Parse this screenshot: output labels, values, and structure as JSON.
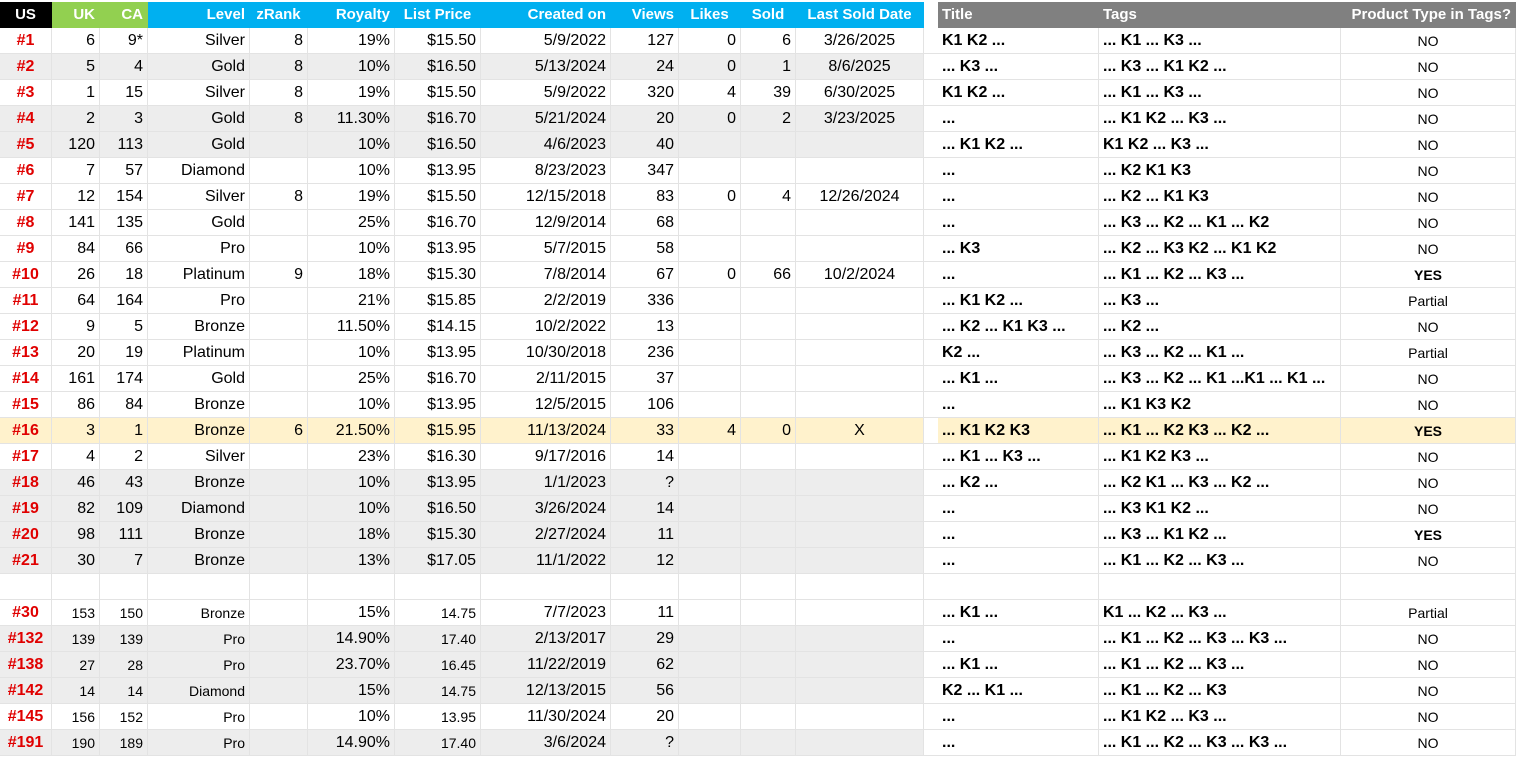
{
  "colors": {
    "us_header": "#000000",
    "uk_ca_header": "#92d050",
    "main_header": "#00b0f0",
    "right_header": "#808080",
    "rank_red": "#e00000",
    "shade": "#ededed",
    "highlight": "#fff2cc"
  },
  "headers": {
    "us": "US",
    "uk": "UK",
    "ca": "CA",
    "level": "Level",
    "zrank": "zRank",
    "royalty": "Royalty",
    "list_price": "List Price",
    "created_on": "Created on",
    "views": "Views",
    "likes": "Likes",
    "sold": "Sold",
    "last_sold_date": "Last Sold Date",
    "title": "Title",
    "tags": "Tags",
    "product_type": "Product Type in Tags?"
  },
  "rows": [
    {
      "us": "#1",
      "uk": "6",
      "ca": "9*",
      "level": "Silver",
      "zrank": "8",
      "royalty": "19%",
      "price": "$15.50",
      "created": "5/9/2022",
      "views": "127",
      "likes": "0",
      "sold": "6",
      "last_sold": "3/26/2025",
      "title": "K1 K2 ...",
      "tags": "... K1 ... K3 ...",
      "ptype": "NO"
    },
    {
      "us": "#2",
      "uk": "5",
      "ca": "4",
      "level": "Gold",
      "zrank": "8",
      "royalty": "10%",
      "price": "$16.50",
      "created": "5/13/2024",
      "views": "24",
      "likes": "0",
      "sold": "1",
      "last_sold": "8/6/2025",
      "title": "... K3 ...",
      "tags": "... K3 ... K1 K2 ...",
      "ptype": "NO"
    },
    {
      "us": "#3",
      "uk": "1",
      "ca": "15",
      "level": "Silver",
      "zrank": "8",
      "royalty": "19%",
      "price": "$15.50",
      "created": "5/9/2022",
      "views": "320",
      "likes": "4",
      "sold": "39",
      "last_sold": "6/30/2025",
      "title": "K1 K2 ...",
      "tags": "... K1 ... K3 ...",
      "ptype": "NO"
    },
    {
      "us": "#4",
      "uk": "2",
      "ca": "3",
      "level": "Gold",
      "zrank": "8",
      "royalty": "11.30%",
      "price": "$16.70",
      "created": "5/21/2024",
      "views": "20",
      "likes": "0",
      "sold": "2",
      "last_sold": "3/23/2025",
      "title": "...",
      "tags": "... K1 K2 ... K3 ...",
      "ptype": "NO"
    },
    {
      "us": "#5",
      "uk": "120",
      "ca": "113",
      "level": "Gold",
      "zrank": "",
      "royalty": "10%",
      "price": "$16.50",
      "created": "4/6/2023",
      "views": "40",
      "likes": "",
      "sold": "",
      "last_sold": "",
      "title": "... K1 K2 ...",
      "tags": "K1 K2 ... K3 ...",
      "ptype": "NO"
    },
    {
      "us": "#6",
      "uk": "7",
      "ca": "57",
      "level": "Diamond",
      "zrank": "",
      "royalty": "10%",
      "price": "$13.95",
      "created": "8/23/2023",
      "views": "347",
      "likes": "",
      "sold": "",
      "last_sold": "",
      "title": "...",
      "tags": "... K2 K1 K3",
      "ptype": "NO"
    },
    {
      "us": "#7",
      "uk": "12",
      "ca": "154",
      "level": "Silver",
      "zrank": "8",
      "royalty": "19%",
      "price": "$15.50",
      "created": "12/15/2018",
      "views": "83",
      "likes": "0",
      "sold": "4",
      "last_sold": "12/26/2024",
      "title": "...",
      "tags": "... K2 ... K1 K3",
      "ptype": "NO"
    },
    {
      "us": "#8",
      "uk": "141",
      "ca": "135",
      "level": "Gold",
      "zrank": "",
      "royalty": "25%",
      "price": "$16.70",
      "created": "12/9/2014",
      "views": "68",
      "likes": "",
      "sold": "",
      "last_sold": "",
      "title": "...",
      "tags": "... K3 ... K2 ... K1 ... K2",
      "ptype": "NO"
    },
    {
      "us": "#9",
      "uk": "84",
      "ca": "66",
      "level": "Pro",
      "zrank": "",
      "royalty": "10%",
      "price": "$13.95",
      "created": "5/7/2015",
      "views": "58",
      "likes": "",
      "sold": "",
      "last_sold": "",
      "title": "... K3",
      "tags": "... K2 ... K3 K2 ... K1 K2",
      "ptype": "NO"
    },
    {
      "us": "#10",
      "uk": "26",
      "ca": "18",
      "level": "Platinum",
      "zrank": "9",
      "royalty": "18%",
      "price": "$15.30",
      "created": "7/8/2014",
      "views": "67",
      "likes": "0",
      "sold": "66",
      "last_sold": "10/2/2024",
      "title": "...",
      "tags": "... K1 ... K2 ... K3 ...",
      "ptype": "YES"
    },
    {
      "us": "#11",
      "uk": "64",
      "ca": "164",
      "level": "Pro",
      "zrank": "",
      "royalty": "21%",
      "price": "$15.85",
      "created": "2/2/2019",
      "views": "336",
      "likes": "",
      "sold": "",
      "last_sold": "",
      "title": "... K1 K2 ...",
      "tags": "... K3 ...",
      "ptype": "Partial"
    },
    {
      "us": "#12",
      "uk": "9",
      "ca": "5",
      "level": "Bronze",
      "zrank": "",
      "royalty": "11.50%",
      "price": "$14.15",
      "created": "10/2/2022",
      "views": "13",
      "likes": "",
      "sold": "",
      "last_sold": "",
      "title": "... K2 ... K1 K3 ...",
      "tags": "... K2 ...",
      "ptype": "NO"
    },
    {
      "us": "#13",
      "uk": "20",
      "ca": "19",
      "level": "Platinum",
      "zrank": "",
      "royalty": "10%",
      "price": "$13.95",
      "created": "10/30/2018",
      "views": "236",
      "likes": "",
      "sold": "",
      "last_sold": "",
      "title": "K2 ...",
      "tags": "... K3 ... K2 ... K1 ...",
      "ptype": "Partial"
    },
    {
      "us": "#14",
      "uk": "161",
      "ca": "174",
      "level": "Gold",
      "zrank": "",
      "royalty": "25%",
      "price": "$16.70",
      "created": "2/11/2015",
      "views": "37",
      "likes": "",
      "sold": "",
      "last_sold": "",
      "title": "... K1 ...",
      "tags": "... K3 ... K2 ... K1 ...K1 ... K1 ...",
      "ptype": "NO"
    },
    {
      "us": "#15",
      "uk": "86",
      "ca": "84",
      "level": "Bronze",
      "zrank": "",
      "royalty": "10%",
      "price": "$13.95",
      "created": "12/5/2015",
      "views": "106",
      "likes": "",
      "sold": "",
      "last_sold": "",
      "title": "...",
      "tags": "... K1 K3 K2",
      "ptype": "NO"
    },
    {
      "us": "#16",
      "uk": "3",
      "ca": "1",
      "level": "Bronze",
      "zrank": "6",
      "royalty": "21.50%",
      "price": "$15.95",
      "created": "11/13/2024",
      "views": "33",
      "likes": "4",
      "sold": "0",
      "last_sold": "X",
      "title": "... K1 K2 K3",
      "tags": "... K1 ... K2 K3 ... K2 ...",
      "ptype": "YES"
    },
    {
      "us": "#17",
      "uk": "4",
      "ca": "2",
      "level": "Silver",
      "zrank": "",
      "royalty": "23%",
      "price": "$16.30",
      "created": "9/17/2016",
      "views": "14",
      "likes": "",
      "sold": "",
      "last_sold": "",
      "title": "... K1 ... K3 ...",
      "tags": "... K1 K2 K3 ...",
      "ptype": "NO"
    },
    {
      "us": "#18",
      "uk": "46",
      "ca": "43",
      "level": "Bronze",
      "zrank": "",
      "royalty": "10%",
      "price": "$13.95",
      "created": "1/1/2023",
      "views": "?",
      "likes": "",
      "sold": "",
      "last_sold": "",
      "title": "... K2 ...",
      "tags": "... K2 K1 ... K3 ... K2 ...",
      "ptype": "NO"
    },
    {
      "us": "#19",
      "uk": "82",
      "ca": "109",
      "level": "Diamond",
      "zrank": "",
      "royalty": "10%",
      "price": "$16.50",
      "created": "3/26/2024",
      "views": "14",
      "likes": "",
      "sold": "",
      "last_sold": "",
      "title": "...",
      "tags": "... K3 K1 K2 ...",
      "ptype": "NO"
    },
    {
      "us": "#20",
      "uk": "98",
      "ca": "111",
      "level": "Bronze",
      "zrank": "",
      "royalty": "18%",
      "price": "$15.30",
      "created": "2/27/2024",
      "views": "11",
      "likes": "",
      "sold": "",
      "last_sold": "",
      "title": "...",
      "tags": "... K3 ... K1 K2 ...",
      "ptype": "YES"
    },
    {
      "us": "#21",
      "uk": "30",
      "ca": "7",
      "level": "Bronze",
      "zrank": "",
      "royalty": "13%",
      "price": "$17.05",
      "created": "11/1/2022",
      "views": "12",
      "likes": "",
      "sold": "",
      "last_sold": "",
      "title": "...",
      "tags": "... K1 ... K2 ... K3 ...",
      "ptype": "NO"
    },
    {
      "us": "",
      "uk": "",
      "ca": "",
      "level": "",
      "zrank": "",
      "royalty": "",
      "price": "",
      "created": "",
      "views": "",
      "likes": "",
      "sold": "",
      "last_sold": "",
      "title": "",
      "tags": "",
      "ptype": ""
    },
    {
      "us": "#30",
      "uk": "153",
      "ca": "150",
      "level": "Bronze",
      "zrank": "",
      "royalty": "15%",
      "price": "14.75",
      "created": "7/7/2023",
      "views": "11",
      "likes": "",
      "sold": "",
      "last_sold": "",
      "title": "... K1 ...",
      "tags": "K1 ... K2 ... K3 ...",
      "ptype": "Partial"
    },
    {
      "us": "#132",
      "uk": "139",
      "ca": "139",
      "level": "Pro",
      "zrank": "",
      "royalty": "14.90%",
      "price": "17.40",
      "created": "2/13/2017",
      "views": "29",
      "likes": "",
      "sold": "",
      "last_sold": "",
      "title": "...",
      "tags": "... K1 ... K2 ... K3 ... K3 ...",
      "ptype": "NO"
    },
    {
      "us": "#138",
      "uk": "27",
      "ca": "28",
      "level": "Pro",
      "zrank": "",
      "royalty": "23.70%",
      "price": "16.45",
      "created": "11/22/2019",
      "views": "62",
      "likes": "",
      "sold": "",
      "last_sold": "",
      "title": "... K1 ...",
      "tags": "... K1 ... K2 ... K3 ...",
      "ptype": "NO"
    },
    {
      "us": "#142",
      "uk": "14",
      "ca": "14",
      "level": "Diamond",
      "zrank": "",
      "royalty": "15%",
      "price": "14.75",
      "created": "12/13/2015",
      "views": "56",
      "likes": "",
      "sold": "",
      "last_sold": "",
      "title": "K2 ... K1 ...",
      "tags": "... K1 ... K2 ... K3",
      "ptype": "NO"
    },
    {
      "us": "#145",
      "uk": "156",
      "ca": "152",
      "level": "Pro",
      "zrank": "",
      "royalty": "10%",
      "price": "13.95",
      "created": "11/30/2024",
      "views": "20",
      "likes": "",
      "sold": "",
      "last_sold": "",
      "title": "...",
      "tags": "... K1 K2 ... K3 ...",
      "ptype": "NO"
    },
    {
      "us": "#191",
      "uk": "190",
      "ca": "189",
      "level": "Pro",
      "zrank": "",
      "royalty": "14.90%",
      "price": "17.40",
      "created": "3/6/2024",
      "views": "?",
      "likes": "",
      "sold": "",
      "last_sold": "",
      "title": "...",
      "tags": "... K1 ... K2 ... K3 ... K3 ...",
      "ptype": "NO"
    }
  ]
}
